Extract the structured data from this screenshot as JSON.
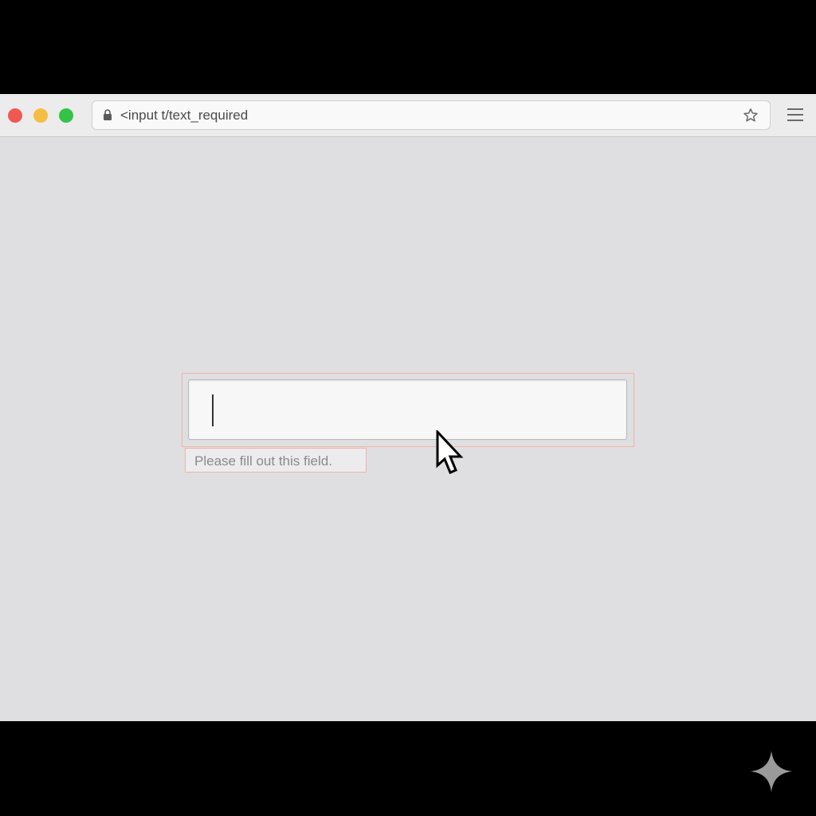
{
  "window": {
    "controls": {
      "close_color": "#ee5a52",
      "minimize_color": "#f5be40",
      "maximize_color": "#34c348"
    }
  },
  "address_bar": {
    "url": "<input t/text_required",
    "lock_icon": "lock-icon",
    "bookmark_icon": "star-icon"
  },
  "toolbar": {
    "menu_icon": "hamburger-menu-icon"
  },
  "form": {
    "input_value": "",
    "focus_color": "#f0b3a8",
    "validation_message": "Please fill out this field."
  },
  "overlay": {
    "cursor_icon": "mouse-pointer-icon",
    "watermark_icon": "sparkle-icon"
  }
}
